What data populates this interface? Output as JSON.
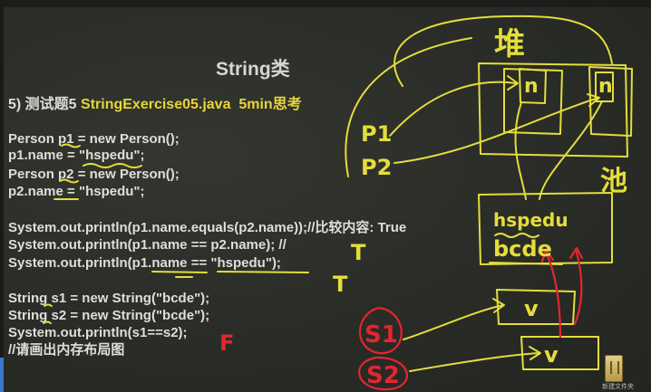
{
  "title": "String类",
  "subtitle": {
    "prefix": "5) 测试题5 ",
    "file": "StringExercise05.java",
    "time": "5min思考"
  },
  "code_lines": [
    "Person p1 = new Person();",
    "p1.name = \"hspedu\";",
    "Person p2 = new Person();",
    "p2.name = \"hspedu\";",
    "",
    "System.out.println(p1.name.equals(p2.name));//比较内容: True",
    "System.out.println(p1.name == p2.name);  //",
    "System.out.println(p1.name == \"hspedu\");",
    "",
    "String s1 = new String(\"bcde\");",
    "String s2 = new String(\"bcde\");",
    "System.out.println(s1==s2);",
    "//请画出内存布局图"
  ],
  "handwriting": {
    "heap": "堆",
    "pool": "池",
    "n": "n",
    "p1": "P1",
    "p2": "P2",
    "hspedu": "hspedu",
    "bcde": "bcde",
    "v": "v",
    "s1": "S1",
    "s2": "S2",
    "t": "T",
    "f": "F"
  },
  "corner_label": "新建文件夹",
  "colors": {
    "board": "#2b2d2a",
    "chalk_yellow": "#e4dd3b",
    "chalk_red": "#e2262f",
    "code_text": "#dededa",
    "code_highlight": "#e7d53a"
  }
}
